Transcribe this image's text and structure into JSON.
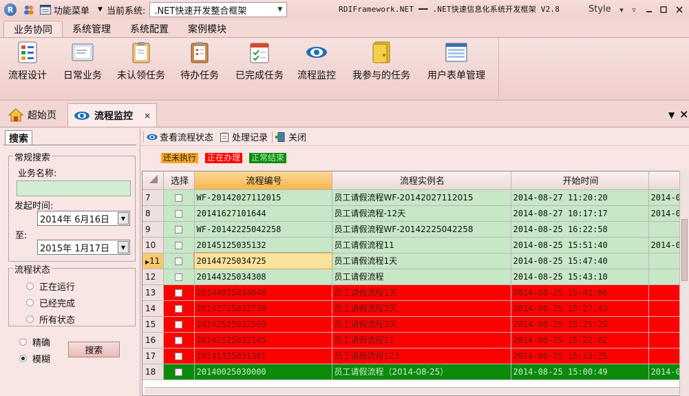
{
  "titlebar": {
    "logo_letter": "R",
    "menu_label": "功能菜单",
    "current_system_label": "当前系统:",
    "current_system_value": ".NET快速开发整合框架",
    "app_title": "RDIFramework.NET ━━ .NET快速信息化系统开发框架 V2.8",
    "style_label": "Style"
  },
  "ribbon_tabs": [
    {
      "label": "业务协同"
    },
    {
      "label": "系统管理"
    },
    {
      "label": "系统配置"
    },
    {
      "label": "案例模块"
    }
  ],
  "ribbon_buttons": [
    {
      "label": "流程设计",
      "icon": "workflow-design-icon"
    },
    {
      "label": "日常业务",
      "icon": "daily-business-icon"
    },
    {
      "label": "未认领任务",
      "icon": "unclaimed-task-icon"
    },
    {
      "label": "待办任务",
      "icon": "todo-task-icon"
    },
    {
      "label": "已完成任务",
      "icon": "completed-task-icon"
    },
    {
      "label": "流程监控",
      "icon": "eye-icon"
    },
    {
      "label": "我参与的任务",
      "icon": "folder-icon"
    },
    {
      "label": "用户表单管理",
      "icon": "form-icon"
    }
  ],
  "doc_tabs": [
    {
      "label": "超始页",
      "icon": "home-icon"
    },
    {
      "label": "流程监控",
      "icon": "eye-icon",
      "close": "×"
    }
  ],
  "doc_controls": {
    "menu": "▼",
    "close": "×"
  },
  "search_panel": {
    "tab_label": "搜索",
    "general_legend": "常规搜索",
    "business_name_label": "业务名称:",
    "business_name_value": "",
    "start_time_label": "发起时间:",
    "start_date": "2014年 6月16日",
    "to_label": "至:",
    "end_date": "2015年 1月17日",
    "status_legend": "流程状态",
    "status_options": [
      {
        "label": "正在运行",
        "selected": false
      },
      {
        "label": "已经完成",
        "selected": false
      },
      {
        "label": "所有状态",
        "selected": false
      }
    ],
    "match_options": [
      {
        "label": "精确",
        "selected": false
      },
      {
        "label": "模糊",
        "selected": true
      }
    ],
    "search_button": "搜索"
  },
  "toolbar": {
    "view_status": "查看流程状态",
    "process_log": "处理记录",
    "close": "关闭"
  },
  "legend": [
    {
      "label": "还未执行",
      "color": "#f5a623"
    },
    {
      "label": "正在办理",
      "color": "#ff0000"
    },
    {
      "label": "正常结束",
      "color": "#0b8a0b"
    }
  ],
  "grid": {
    "columns": [
      "",
      "选择",
      "流程编号",
      "流程实例名",
      "开始时间",
      ""
    ],
    "rows": [
      {
        "n": "7",
        "id": "WF-20142027112015",
        "name": "员工请假流程WF-20142027112015",
        "start": "2014-08-27 11:20:20",
        "extra": "2014-0",
        "state": "green"
      },
      {
        "n": "8",
        "id": "20141627101644",
        "name": "员工请假流程-12天",
        "start": "2014-08-27 10:17:17",
        "extra": "2014-0",
        "state": "green"
      },
      {
        "n": "9",
        "id": "WF-20142225042258",
        "name": "员工请假流程WF-20142225042258",
        "start": "2014-08-25 16:22:58",
        "extra": "",
        "state": "green"
      },
      {
        "n": "10",
        "id": "20145125035132",
        "name": "员工请假流程11",
        "start": "2014-08-25 15:51:40",
        "extra": "2014-0",
        "state": "green"
      },
      {
        "n": "11",
        "id": "20144725034725",
        "name": "员工请假流程1天",
        "start": "2014-08-25 15:47:40",
        "extra": "",
        "state": "green",
        "current": true
      },
      {
        "n": "12",
        "id": "20144325034308",
        "name": "员工请假流程",
        "start": "2014-08-25 15:43:10",
        "extra": "",
        "state": "green"
      },
      {
        "n": "13",
        "id": "20144025034048",
        "name": "员工请假流程1天",
        "start": "2014-08-25 15:41:06",
        "extra": "",
        "state": "red"
      },
      {
        "n": "14",
        "id": "20142725032730",
        "name": "员工请假流程2天",
        "start": "2014-08-25 15:27:43",
        "extra": "",
        "state": "red"
      },
      {
        "n": "15",
        "id": "20142525032509",
        "name": "员工请假流程3天",
        "start": "2014-08-25 15:25:29",
        "extra": "",
        "state": "red"
      },
      {
        "n": "16",
        "id": "20142125032145",
        "name": "员工请假流程11",
        "start": "2014-08-25 15:22:02",
        "extra": "",
        "state": "red"
      },
      {
        "n": "17",
        "id": "20141325031301",
        "name": "员工请假流程123",
        "start": "2014-08-25 15:13:25",
        "extra": "",
        "state": "red"
      },
      {
        "n": "18",
        "id": "20140025030000",
        "name": "员工请假流程（2014-08-25）",
        "start": "2014-08-25 15:00:49",
        "extra": "2014-0",
        "state": "dkgreen"
      }
    ]
  }
}
